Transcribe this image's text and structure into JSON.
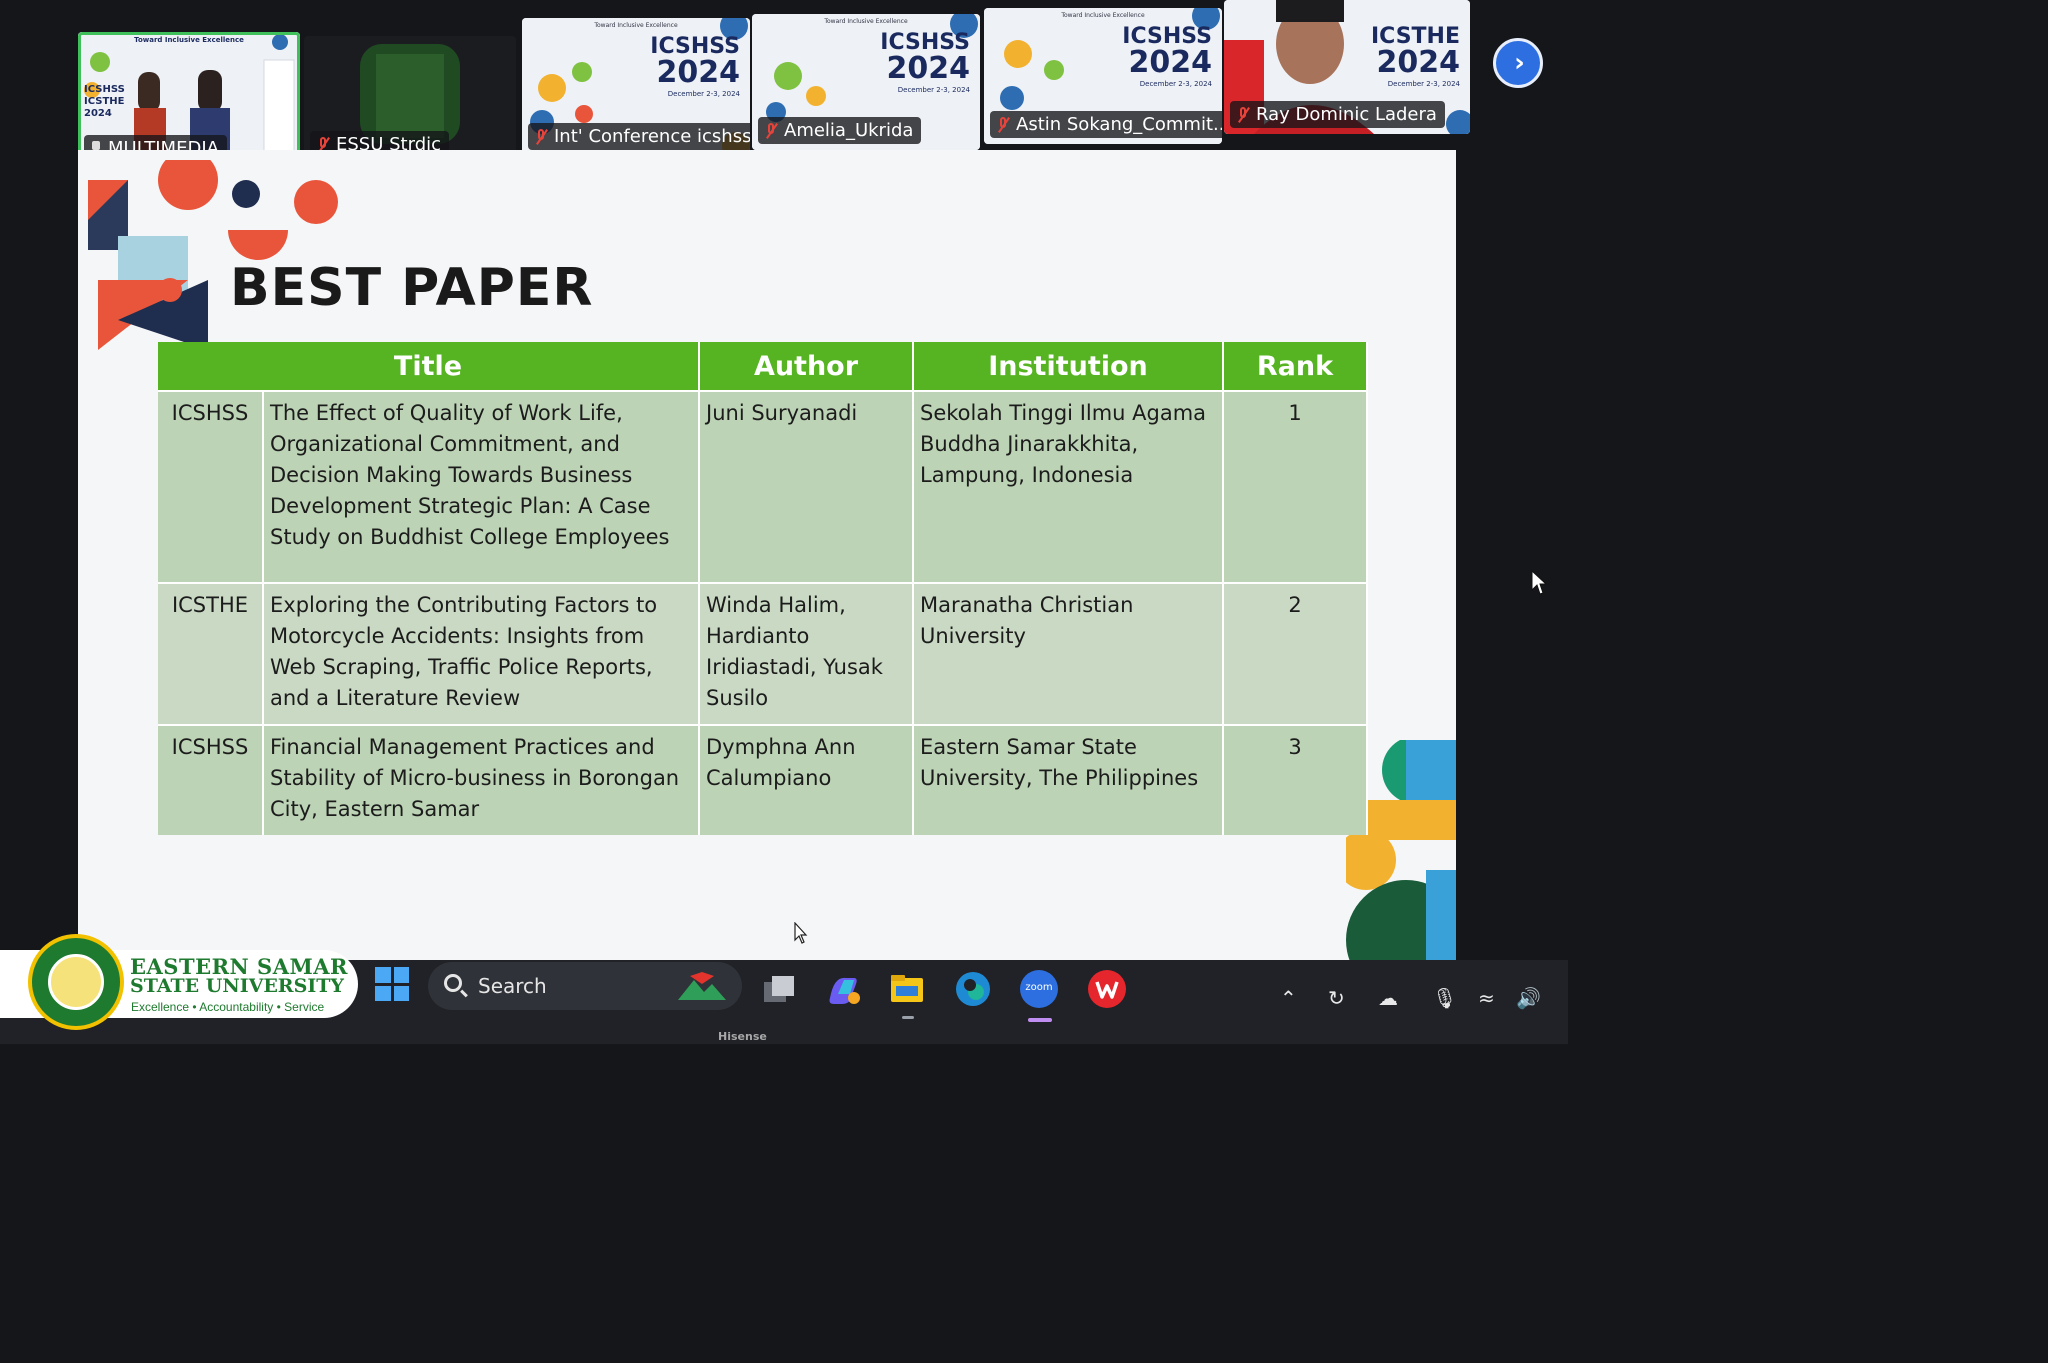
{
  "participants": [
    {
      "name": "MULTIMEDIA",
      "muted": false,
      "pinned": true,
      "selected": true
    },
    {
      "name": "ESSU Strdic",
      "muted": true
    },
    {
      "name": "Int' Conference icshss",
      "muted": true
    },
    {
      "name": "Amelia_Ukrida",
      "muted": true
    },
    {
      "name": "Astin Sokang_Commit...",
      "muted": true
    },
    {
      "name": "Ray Dominic Ladera",
      "muted": true
    }
  ],
  "posters": [
    {
      "p1": "ICSHSS",
      "p2": "2024",
      "p3": "December 2-3, 2024"
    },
    {
      "p1": "ICSHSS",
      "p2": "2024",
      "p3": "December 2-3, 2024"
    },
    {
      "p1": "ICSHSS",
      "p2": "2024",
      "p3": "December 2-3, 2024"
    },
    {
      "p1": "ICSTHE",
      "p2": "2024",
      "p3": "December 2-3, 2024"
    }
  ],
  "poster_header": "Toward Inclusive Excellence",
  "multimedia_tile": {
    "head": "Toward Inclusive Excellence",
    "labels": [
      "ICSHSS",
      "ICSTHE",
      "2024"
    ]
  },
  "slide": {
    "title": "BEST PAPER",
    "table": {
      "headers": [
        "Title",
        "Author",
        "Institution",
        "Rank"
      ],
      "rows": [
        {
          "conference": "ICSHSS",
          "title": "The Effect of Quality of Work Life, Organizational Commitment, and Decision Making Towards Business Development Strategic Plan: A Case Study on Buddhist College Employees",
          "author": "Juni Suryanadi",
          "institution": "Sekolah Tinggi Ilmu Agama Buddha Jinarakkhita, Lampung, Indonesia",
          "rank": "1"
        },
        {
          "conference": "ICSTHE",
          "title": "Exploring the Contributing Factors to Motorcycle Accidents: Insights from Web Scraping, Traffic Police Reports, and a Literature Review",
          "author": "Winda Halim, Hardianto Iridiastadi, Yusak Susilo",
          "institution": "Maranatha Christian University",
          "rank": "2"
        },
        {
          "conference": "ICSHSS",
          "title": "Financial Management Practices and Stability of Micro-business in Borongan City, Eastern Samar",
          "author": "Dymphna Ann Calumpiano",
          "institution": "Eastern Samar State University, The Philippines",
          "rank": "3"
        }
      ]
    }
  },
  "watermark": {
    "line1": "EASTERN SAMAR",
    "line2": "STATE UNIVERSITY",
    "tagline": "Excellence • Accountability • Service"
  },
  "taskbar": {
    "search_label": "Search",
    "apps": [
      "windows-start-icon",
      "task-view-icon",
      "copilot-icon",
      "file-explorer-icon",
      "edge-icon",
      "zoom-icon",
      "wps-office-icon"
    ],
    "zoom_label": "zoom"
  },
  "monitor_brand": "Hisense",
  "colors": {
    "header_green": "#56b423",
    "row_green": "#bcd3b5",
    "zoom_blue": "#2d6fe0"
  }
}
